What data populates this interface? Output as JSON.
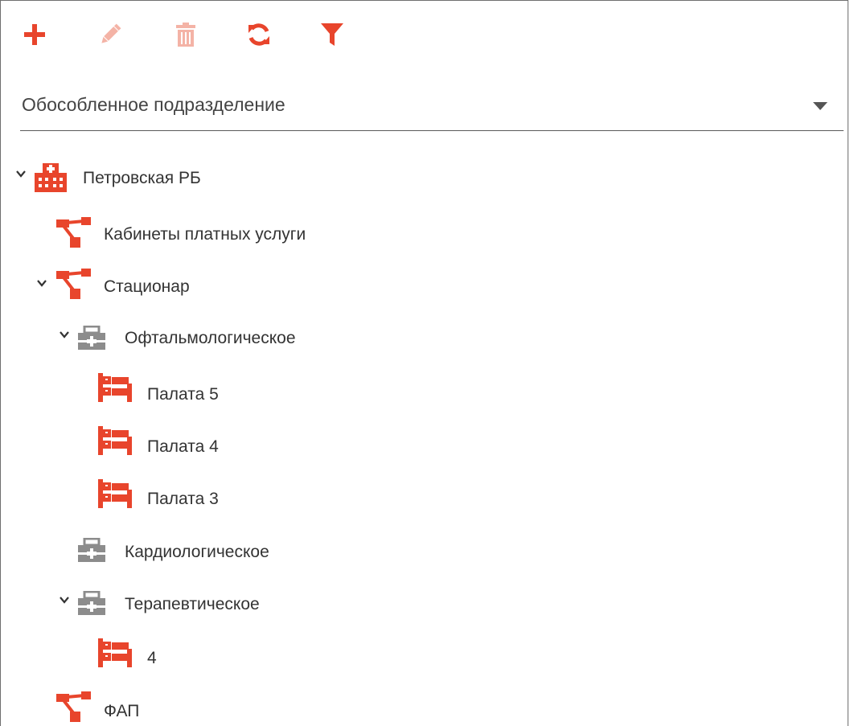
{
  "colors": {
    "accent": "#e8452c",
    "accent_disabled": "#f4b3a6",
    "gray_icon": "#8c8c8c",
    "text": "#333333"
  },
  "toolbar": {
    "items": [
      {
        "icon": "plus-icon",
        "enabled": true
      },
      {
        "icon": "pencil-icon",
        "enabled": false
      },
      {
        "icon": "trash-icon",
        "enabled": false
      },
      {
        "icon": "refresh-icon",
        "enabled": true
      },
      {
        "icon": "filter-icon",
        "enabled": true
      }
    ]
  },
  "select": {
    "value": "Обособленное подразделение",
    "icon": "caret-down-icon"
  },
  "tree": {
    "nodes": [
      {
        "label": "Петровская РБ",
        "icon": "hospital-icon",
        "expanded": true
      },
      {
        "label": "Кабинеты платных услуги",
        "icon": "structure-icon"
      },
      {
        "label": "Стационар",
        "icon": "structure-icon",
        "expanded": true
      },
      {
        "label": "Офтальмологическое",
        "icon": "medkit-icon",
        "expanded": true
      },
      {
        "label": "Палата 5",
        "icon": "bed-icon"
      },
      {
        "label": "Палата 4",
        "icon": "bed-icon"
      },
      {
        "label": "Палата 3",
        "icon": "bed-icon"
      },
      {
        "label": "Кардиологическое",
        "icon": "medkit-icon"
      },
      {
        "label": "Терапевтическое",
        "icon": "medkit-icon",
        "expanded": true
      },
      {
        "label": "4",
        "icon": "bed-icon"
      },
      {
        "label": "ФАП",
        "icon": "structure-icon"
      }
    ]
  }
}
